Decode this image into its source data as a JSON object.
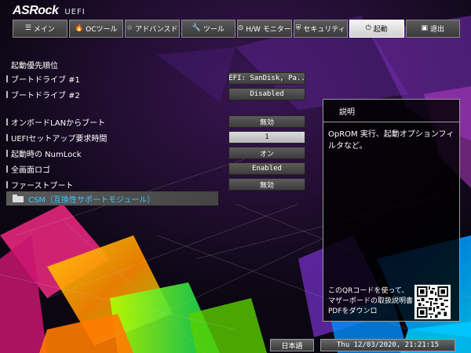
{
  "brand": {
    "logo": "ASRock",
    "subtitle": "UEFI"
  },
  "tabs": [
    {
      "label": "メイン",
      "icon": "list-icon",
      "glyph": "☰",
      "active": false
    },
    {
      "label": "OCツール",
      "icon": "flame-icon",
      "glyph": "🔥",
      "active": false
    },
    {
      "label": "アドバンスド",
      "icon": "star-icon",
      "glyph": "☆",
      "active": false
    },
    {
      "label": "ツール",
      "icon": "wrench-icon",
      "glyph": "🔧",
      "active": false
    },
    {
      "label": "H/W モニター",
      "icon": "monitor-icon",
      "glyph": "⊙",
      "active": false
    },
    {
      "label": "セキュリティ",
      "icon": "shield-icon",
      "glyph": "⛨",
      "active": false
    },
    {
      "label": "起動",
      "icon": "power-icon",
      "glyph": "⏻",
      "active": true
    },
    {
      "label": "退出",
      "icon": "exit-icon",
      "glyph": "▣",
      "active": false
    }
  ],
  "section": {
    "title": "起動優先順位"
  },
  "settings": [
    {
      "label": "ブートドライブ #1",
      "value": "UEFI: SanDisk, Pa..."
    },
    {
      "label": "ブートドライブ #2",
      "value": "Disabled"
    },
    {
      "label": "オンボードLANからブート",
      "value": "無効"
    },
    {
      "label": "UEFIセットアップ要求時間",
      "value": "1"
    },
    {
      "label": "起動時の NumLock",
      "value": "オン"
    },
    {
      "label": "全画面ロゴ",
      "value": "Enabled"
    },
    {
      "label": "ファーストブート",
      "value": "無効"
    }
  ],
  "csm": {
    "label": "CSM（互換性サポートモジュール）"
  },
  "help": {
    "title": "説明",
    "description": "OpROM 実行、起動オプションフィルタなど。",
    "qr_text": "このQRコードを使って、マザーボードの取扱説明書PDFをダウンロ"
  },
  "footer": {
    "language": "日本語",
    "datetime": "Thu 12/03/2020, 21:21:15"
  },
  "colors": {
    "accent_cyan": "#3cc8ff",
    "active_tab": "#e6e6e6",
    "panel_border": "#9a9a9a"
  }
}
